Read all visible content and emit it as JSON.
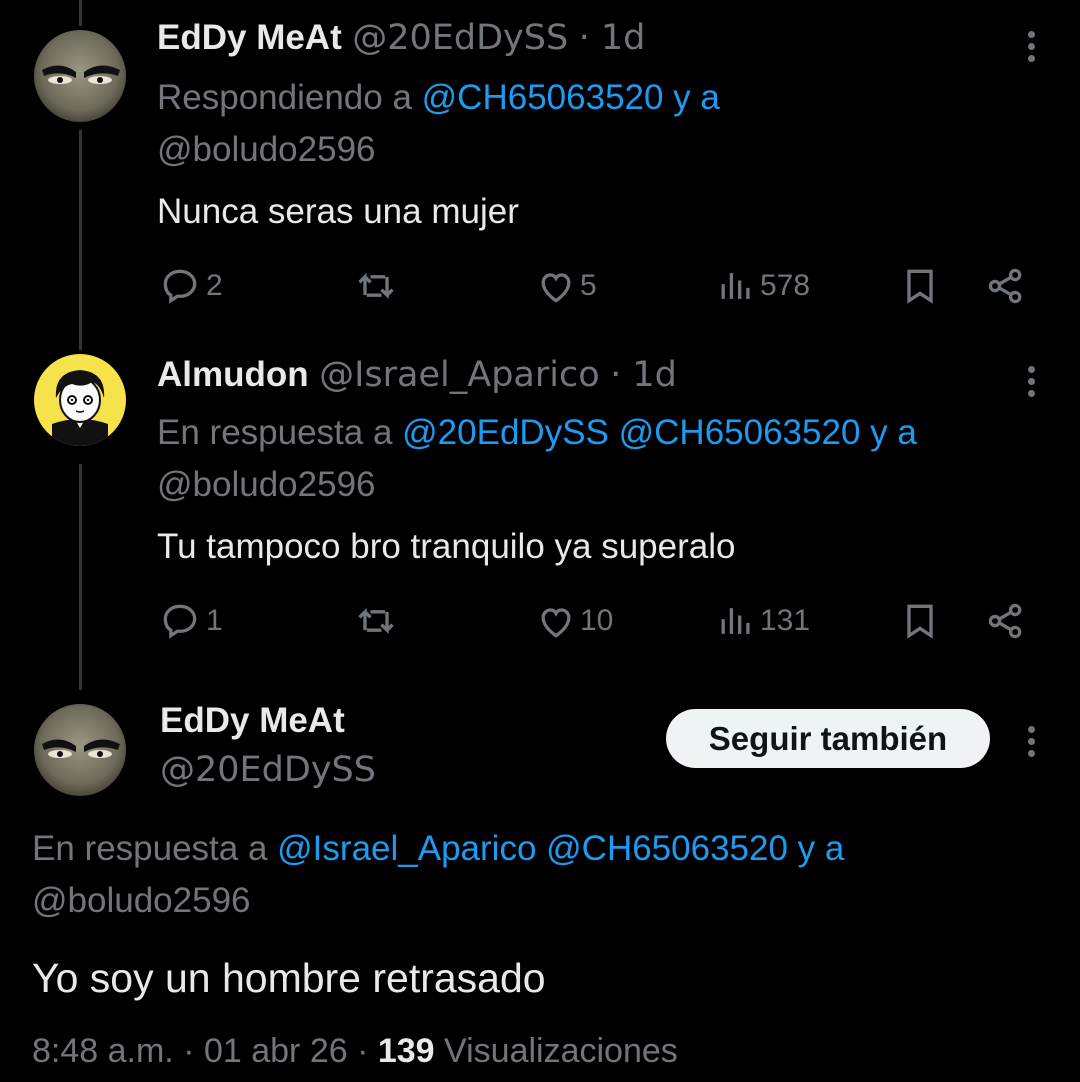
{
  "tweets": [
    {
      "name": "EdDy MeAt",
      "handle": "@20EdDySS",
      "time": "· 1d",
      "reply_prefix": "Respondiendo a ",
      "reply_mentions_line1": "@CH65063520 y a",
      "reply_mentions_line2": "@boludo2596",
      "text": "Nunca seras una mujer",
      "replies": "2",
      "likes": "5",
      "views": "578"
    },
    {
      "name": "Almudon",
      "handle": "@Israel_Aparico",
      "time": "· 1d",
      "reply_prefix": "En respuesta a ",
      "reply_mentions_line1": "@20EdDySS @CH65063520 y a",
      "reply_mentions_line2": "@boludo2596",
      "text": "Tu tampoco bro tranquilo ya superalo",
      "replies": "1",
      "likes": "10",
      "views": "131"
    }
  ],
  "main_tweet": {
    "name": "EdDy MeAt",
    "handle": "@20EdDySS",
    "follow_label": "Seguir también",
    "reply_prefix": "En respuesta a ",
    "reply_mentions_line1": "@Israel_Aparico @CH65063520 y a",
    "reply_mentions_line2": "@boludo2596",
    "text": "Yo soy un hombre retrasado",
    "time": "8:48 a.m.",
    "sep1": " · ",
    "date": "01 abr 26",
    "sep2": " · ",
    "views_count": "139",
    "views_label": " Visualizaciones"
  },
  "colors": {
    "background": "#000000",
    "link": "#1d9bf0",
    "muted": "#71767b",
    "text": "#e7e9ea"
  },
  "icons": [
    "reply-icon",
    "retweet-icon",
    "like-icon",
    "views-icon",
    "bookmark-icon",
    "share-icon",
    "more-icon"
  ]
}
